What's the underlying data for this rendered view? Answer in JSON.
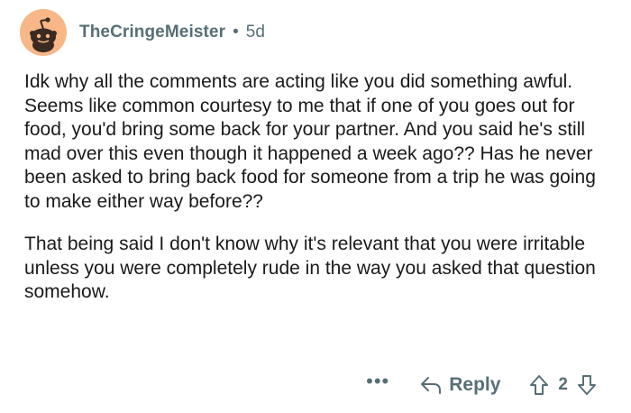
{
  "comment": {
    "username": "TheCringeMeister",
    "separator": "•",
    "age": "5d",
    "paragraphs": [
      "Idk why all the comments are acting like you did something awful. Seems like common courtesy to me that if one of you goes out for food, you'd bring some back for your partner. And you said he's still mad over this even though it happened a week ago?? Has he never been asked to bring back food for someone from a trip he was going to make either way before??",
      "That being said I don't know why it's relevant that you were irritable unless you were completely rude in the way you asked that question somehow."
    ],
    "actions": {
      "more": "•••",
      "reply_label": "Reply",
      "score": "2"
    }
  },
  "icons": {
    "avatar": "reddit-snoo-avatar-icon",
    "reply": "reply-arrow-icon",
    "upvote": "upvote-arrow-icon",
    "downvote": "downvote-arrow-icon"
  },
  "colors": {
    "meta_text": "#576f76",
    "body_text": "#1a1a1b",
    "avatar_bg": "#f7b786"
  }
}
